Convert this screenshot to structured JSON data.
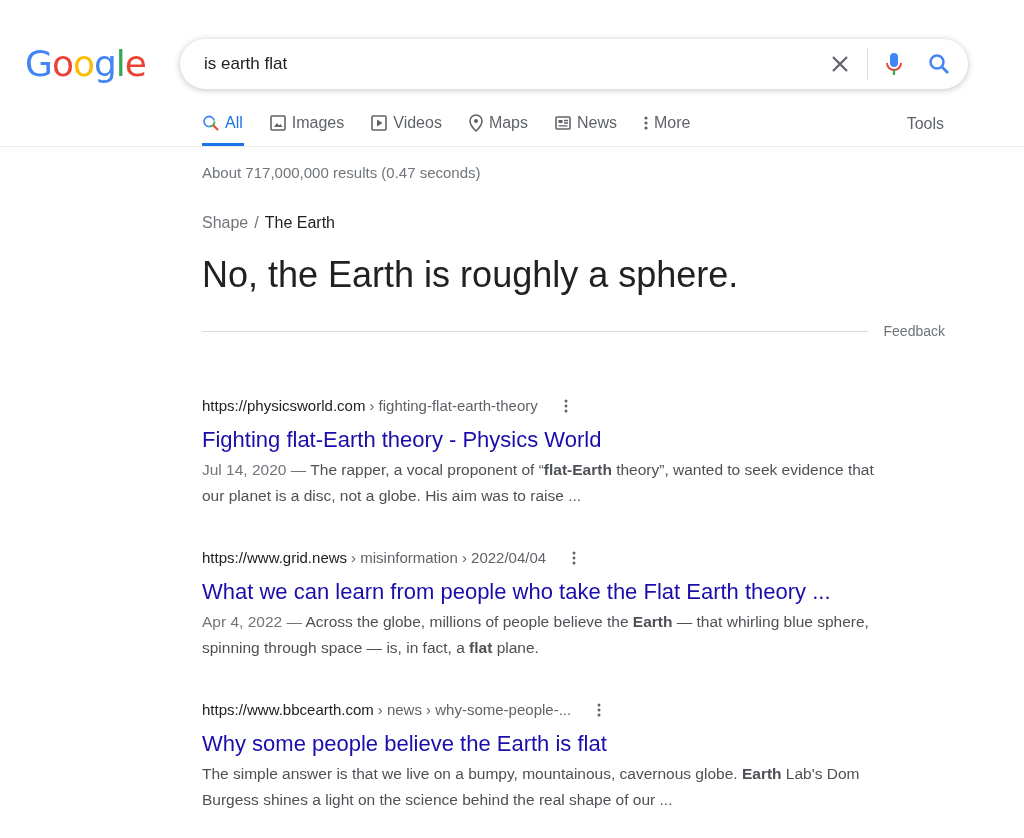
{
  "logo": "Google",
  "search": {
    "value": "is earth flat"
  },
  "tabs": [
    {
      "kind": "all",
      "label": "All",
      "selected": true
    },
    {
      "kind": "images",
      "label": "Images",
      "selected": false
    },
    {
      "kind": "videos",
      "label": "Videos",
      "selected": false
    },
    {
      "kind": "maps",
      "label": "Maps",
      "selected": false
    },
    {
      "kind": "news",
      "label": "News",
      "selected": false
    },
    {
      "kind": "more",
      "label": "More",
      "selected": false
    }
  ],
  "tools": "Tools",
  "stats": "About 717,000,000 results (0.47 seconds)",
  "answer": {
    "breadcrumb": [
      "Shape",
      "The Earth"
    ],
    "separator": "/",
    "title": "No, the Earth is roughly a sphere.",
    "feedback": "Feedback"
  },
  "results": [
    {
      "url": "https://physicsworld.com",
      "path": "› fighting-flat-earth-theory",
      "title": "Fighting flat-Earth theory - Physics World",
      "date": "Jul 14, 2020 —",
      "snippet": "The rapper, a vocal proponent of “**flat-Earth** theory”, wanted to seek evidence that our planet is a disc, not a globe. His aim was to raise ..."
    },
    {
      "url": "https://www.grid.news",
      "path": "› misinformation › 2022/04/04",
      "title": "What we can learn from people who take the Flat Earth theory ...",
      "date": "Apr 4, 2022 —",
      "snippet": "Across the globe, millions of people believe the **Earth** — that whirling blue sphere, spinning through space — is, in fact, a **flat** plane."
    },
    {
      "url": "https://www.bbcearth.com",
      "path": "› news › why-some-people-...",
      "title": "Why some people believe the Earth is flat",
      "snippet": "The simple answer is that we live on a bumpy, mountainous, cavernous globe. **Earth** Lab's Dom Burgess shines a light on the science behind the real shape of our ..."
    }
  ]
}
